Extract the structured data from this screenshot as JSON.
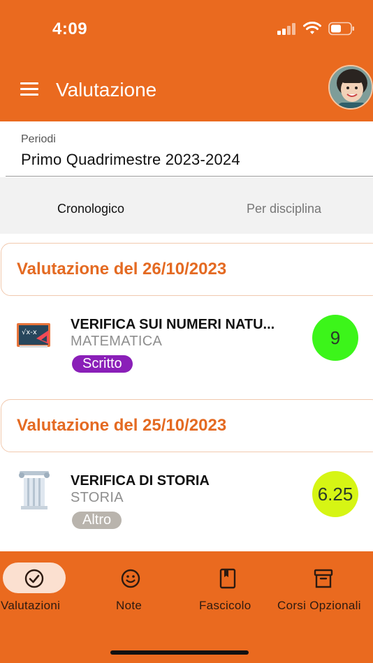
{
  "status_bar": {
    "time": "4:09"
  },
  "header": {
    "title": "Valutazione"
  },
  "period": {
    "label": "Periodi",
    "value": "Primo Quadrimestre 2023-2024"
  },
  "tabs": [
    {
      "label": "Cronologico",
      "active": true
    },
    {
      "label": "Per disciplina",
      "active": false
    }
  ],
  "groups": [
    {
      "date_label": "Valutazione del 26/10/2023",
      "item": {
        "title": "VERIFICA SUI NUMERI NATU...",
        "subject": "MATEMATICA",
        "type": "Scritto",
        "type_color": "#8a1fb8",
        "grade": "9",
        "grade_color": "#3cf51a",
        "icon": "blackboard-icon"
      }
    },
    {
      "date_label": "Valutazione del 25/10/2023",
      "item": {
        "title": "VERIFICA DI STORIA",
        "subject": "STORIA",
        "type": "Altro",
        "type_color": "#b9b4ad",
        "grade": "6.25",
        "grade_color": "#d6f514",
        "icon": "greek-column-icon"
      }
    }
  ],
  "bottom_nav": [
    {
      "label": "Valutazioni",
      "icon": "check-circle-icon",
      "active": true
    },
    {
      "label": "Note",
      "icon": "smiley-icon",
      "active": false
    },
    {
      "label": "Fascicolo",
      "icon": "book-icon",
      "active": false
    },
    {
      "label": "Corsi Opzionali",
      "icon": "archive-icon",
      "active": false
    }
  ],
  "colors": {
    "primary": "#ea6a1f",
    "accent_text": "#e46a22"
  }
}
